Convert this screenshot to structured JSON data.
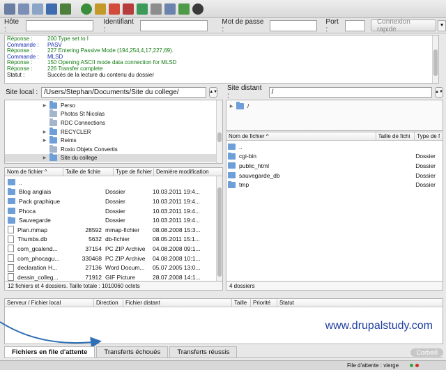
{
  "quickconnect": {
    "host_label": "Hôte :",
    "user_label": "Identifiant :",
    "pass_label": "Mot de passe :",
    "port_label": "Port :",
    "connect_button": "Connexion rapide",
    "dropdown_arrow": "▼"
  },
  "log": [
    {
      "key": "Réponse :",
      "text": "200 Type set to I",
      "color": "green"
    },
    {
      "key": "Commande :",
      "text": "PASV",
      "color": "blue"
    },
    {
      "key": "Réponse :",
      "text": "227 Entering Passive Mode (194,254,4,17,227,69).",
      "color": "green"
    },
    {
      "key": "Commande :",
      "text": "MLSD",
      "color": "blue"
    },
    {
      "key": "Réponse :",
      "text": "150 Opening ASCII mode data connection for MLSD",
      "color": "green"
    },
    {
      "key": "Réponse :",
      "text": "226 Transfer complete",
      "color": "green"
    },
    {
      "key": "Statut :",
      "text": "Succès de la lecture du contenu du dossier",
      "color": "black"
    }
  ],
  "local": {
    "label": "Site local :",
    "path": "/Users/Stephan/Documents/Site du college/",
    "tree": [
      {
        "name": "Perso",
        "expandable": true
      },
      {
        "name": "Photos St Nicolas",
        "expandable": false
      },
      {
        "name": "RDC Connections",
        "expandable": false
      },
      {
        "name": "RECYCLER",
        "expandable": true
      },
      {
        "name": "Reims",
        "expandable": true
      },
      {
        "name": "Roxio Objets Convertis",
        "expandable": false
      },
      {
        "name": "Site du college",
        "expandable": true,
        "selected": true
      }
    ],
    "columns": [
      "Nom de fichier ^",
      "Taille de fichie",
      "Type de fichier",
      "Dernière modification"
    ],
    "files": [
      {
        "name": "..",
        "size": "",
        "type": "",
        "date": "",
        "kind": "folder"
      },
      {
        "name": "Blog anglais",
        "size": "",
        "type": "Dossier",
        "date": "10.03.2011 19:4...",
        "kind": "folder"
      },
      {
        "name": "Pack graphique",
        "size": "",
        "type": "Dossier",
        "date": "10.03.2011 19:4...",
        "kind": "folder"
      },
      {
        "name": "Phoca",
        "size": "",
        "type": "Dossier",
        "date": "10.03.2011 19:4...",
        "kind": "folder"
      },
      {
        "name": "Sauvegarde",
        "size": "",
        "type": "Dossier",
        "date": "10.03.2011 19:4...",
        "kind": "folder"
      },
      {
        "name": "Plan.mmap",
        "size": "28592",
        "type": "mmap-fichier",
        "date": "08.08.2008 15:3...",
        "kind": "file"
      },
      {
        "name": "Thumbs.db",
        "size": "5632",
        "type": "db-fichier",
        "date": "08.05.2011 15:1...",
        "kind": "file"
      },
      {
        "name": "com_gcalend...",
        "size": "37154",
        "type": "PC ZIP Archive",
        "date": "04.08.2008 09:1...",
        "kind": "file"
      },
      {
        "name": "com_phocagu...",
        "size": "330468",
        "type": "PC ZIP Archive",
        "date": "04.08.2008 10:1...",
        "kind": "file"
      },
      {
        "name": "declaration H...",
        "size": "27136",
        "type": "Word Docum...",
        "date": "05.07.2005 13:0...",
        "kind": "file"
      },
      {
        "name": "dessin_colleg...",
        "size": "71912",
        "type": "GIF Picture",
        "date": "28.07.2008 14:1...",
        "kind": "file"
      }
    ],
    "status": "12 fichiers et 4 dossiers. Taille totale : 1010060 octets"
  },
  "remote": {
    "label": "Site distant :",
    "path": "/",
    "tree_root": "/",
    "columns": [
      "Nom de fichier ^",
      "Taille de fichi",
      "Type de f"
    ],
    "files": [
      {
        "name": "..",
        "type": ""
      },
      {
        "name": "cgi-bin",
        "type": "Dossier"
      },
      {
        "name": "public_html",
        "type": "Dossier"
      },
      {
        "name": "sauvegarde_db",
        "type": "Dossier"
      },
      {
        "name": "tmp",
        "type": "Dossier"
      }
    ],
    "status": "4 dossiers"
  },
  "queue": {
    "columns": [
      "Serveur / Fichier local",
      "Direction",
      "Fichier distant",
      "Taille",
      "Priorité",
      "Statut"
    ]
  },
  "watermark": "www.drupalstudy.com",
  "tabs": [
    "Fichiers en file d'attente",
    "Transferts échoués",
    "Transferts réussis"
  ],
  "corbeille": "Corbeill",
  "bottom_status": "File d'attente : vierge",
  "colors": {
    "accent": "#1e3ea0",
    "arrow": "#2f6fb5"
  }
}
